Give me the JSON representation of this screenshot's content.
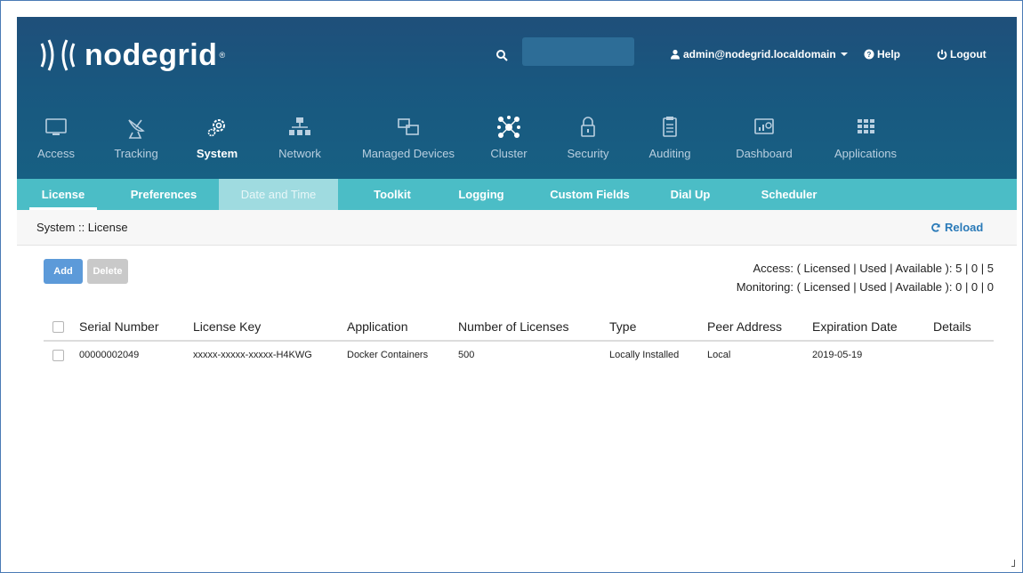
{
  "brand": {
    "name": "nodegrid",
    "reg": "®"
  },
  "header": {
    "search_placeholder": "",
    "user": "admin@nodegrid.localdomain",
    "help": "Help",
    "logout": "Logout"
  },
  "main_nav": [
    {
      "label": "Access",
      "icon": "monitor-icon"
    },
    {
      "label": "Tracking",
      "icon": "satellite-dish-icon"
    },
    {
      "label": "System",
      "icon": "gear-icon"
    },
    {
      "label": "Network",
      "icon": "network-tree-icon"
    },
    {
      "label": "Managed Devices",
      "icon": "devices-icon"
    },
    {
      "label": "Cluster",
      "icon": "cluster-icon"
    },
    {
      "label": "Security",
      "icon": "lock-icon"
    },
    {
      "label": "Auditing",
      "icon": "clipboard-icon"
    },
    {
      "label": "Dashboard",
      "icon": "dashboard-icon"
    },
    {
      "label": "Applications",
      "icon": "grid-icon"
    }
  ],
  "sub_nav": [
    "License",
    "Preferences",
    "Date and Time",
    "Toolkit",
    "Logging",
    "Custom Fields",
    "Dial Up",
    "Scheduler"
  ],
  "breadcrumb": "System :: License",
  "reload": "Reload",
  "buttons": {
    "add": "Add",
    "delete": "Delete"
  },
  "stats": {
    "access": "Access: ( Licensed | Used | Available ): 5 | 0 | 5",
    "monitoring": "Monitoring: ( Licensed | Used | Available ): 0 | 0 | 0"
  },
  "table": {
    "headers": [
      "Serial Number",
      "License Key",
      "Application",
      "Number of Licenses",
      "Type",
      "Peer Address",
      "Expiration Date",
      "Details"
    ],
    "rows": [
      [
        "00000002049",
        "xxxxx-xxxxx-xxxxx-H4KWG",
        "Docker Containers",
        "500",
        "Locally Installed",
        "Local",
        "2019-05-19",
        ""
      ]
    ]
  },
  "colors": {
    "header_bg": "#1d5a82",
    "subnav_bg": "#4bbdc6",
    "accent": "#2a7ab8",
    "add_button": "#5c9ad9"
  }
}
